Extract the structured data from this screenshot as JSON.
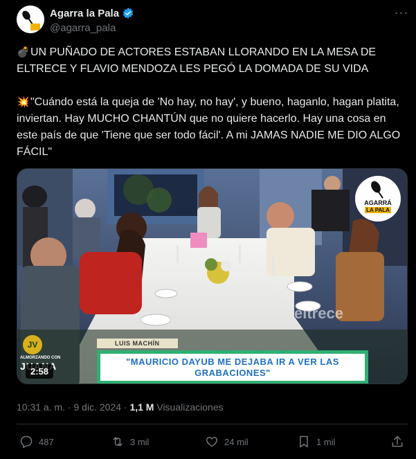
{
  "account": {
    "display_name": "Agarra la Pala",
    "handle": "@agarra_pala",
    "avatar_text_top": "AGARRÁ",
    "avatar_text_bottom": "LA PALA"
  },
  "tweet": {
    "line1_emoji": "💣",
    "line1": "UN PUÑADO DE ACTORES ESTABAN LLORANDO EN LA MESA DE ELTRECE Y FLAVIO MENDOZA LES PEGÓ LA DOMADA DE SU VIDA",
    "line2_emoji": "💥",
    "line2": "\"Cuándo está la queja de 'No hay, no hay', y bueno, haganlo, hagan platita, inviertan. Hay MUCHO CHANTÚN que no quiere hacerlo. Hay una cosa en este país de que 'Tiene que ser todo fácil'. A mi JAMAS NADIE ME DIO ALGO FÁCIL\""
  },
  "video": {
    "duration": "2:58",
    "lower_third_name": "LUIS MACHÍN",
    "lower_third_line1": "\"MAURICIO DAYUB ME DEJABA IR A VER LAS",
    "lower_third_line2": "GRABACIONES\"",
    "channel_watermark": "eltrece",
    "corner_badge": "JV",
    "corner_small_text": "ALMORZANDO CON",
    "corner_big_text": "JUANA",
    "watermark_top": "AGARRÁ",
    "watermark_bottom": "LA PALA"
  },
  "meta": {
    "time": "10:31 a. m.",
    "separator": "·",
    "date": "9 dic. 2024",
    "views_count": "1,1 M",
    "views_label": "Visualizaciones"
  },
  "actions": {
    "replies": "487",
    "reposts": "3 mil",
    "likes": "24 mil",
    "bookmarks": "1 mil"
  },
  "colors": {
    "background": "#000000",
    "text": "#e7e9ea",
    "secondary": "#71767b",
    "verified": "#1d9bf0",
    "lower_third_green": "#2fb073",
    "lower_third_text": "#1e6fc0"
  }
}
